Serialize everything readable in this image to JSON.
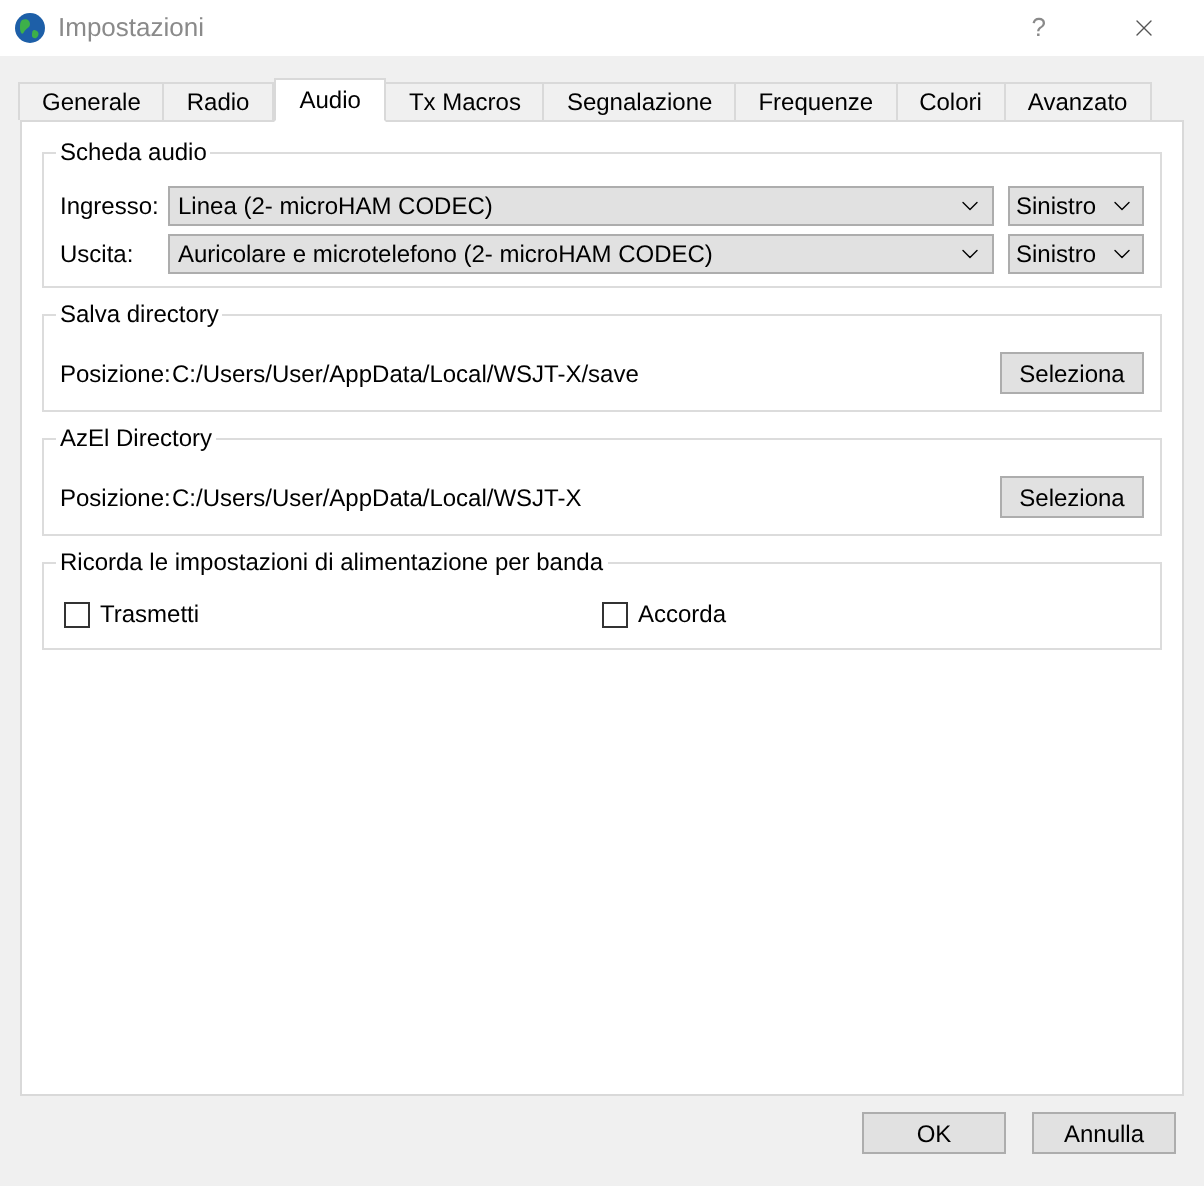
{
  "window": {
    "title": "Impostazioni",
    "help": "?"
  },
  "tabs": [
    {
      "label": "Generale",
      "selected": false
    },
    {
      "label": "Radio",
      "selected": false
    },
    {
      "label": "Audio",
      "selected": true
    },
    {
      "label": "Tx Macros",
      "selected": false
    },
    {
      "label": "Segnalazione",
      "selected": false
    },
    {
      "label": "Frequenze",
      "selected": false
    },
    {
      "label": "Colori",
      "selected": false
    },
    {
      "label": "Avanzato",
      "selected": false
    }
  ],
  "groups": [
    {
      "kind": "devices",
      "title": "Scheda audio",
      "rows": [
        {
          "label": "Ingresso:",
          "device": "Linea (2- microHAM CODEC)",
          "channel": "Sinistro"
        },
        {
          "label": "Uscita:",
          "device": "Auricolare e microtelefono (2- microHAM CODEC)",
          "channel": "Sinistro"
        }
      ]
    },
    {
      "kind": "path",
      "title": "Salva directory",
      "label": "Posizione:",
      "value": "C:/Users/User/AppData/Local/WSJT-X/save",
      "button": "Seleziona"
    },
    {
      "kind": "path",
      "title": "AzEl Directory",
      "label": "Posizione:",
      "value": "C:/Users/User/AppData/Local/WSJT-X",
      "button": "Seleziona"
    },
    {
      "kind": "checks",
      "title": "Ricorda le impostazioni di alimentazione per banda",
      "items": [
        {
          "label": "Trasmetti",
          "checked": false
        },
        {
          "label": "Accorda",
          "checked": false
        }
      ]
    }
  ],
  "buttons": [
    "OK",
    "Annulla"
  ]
}
